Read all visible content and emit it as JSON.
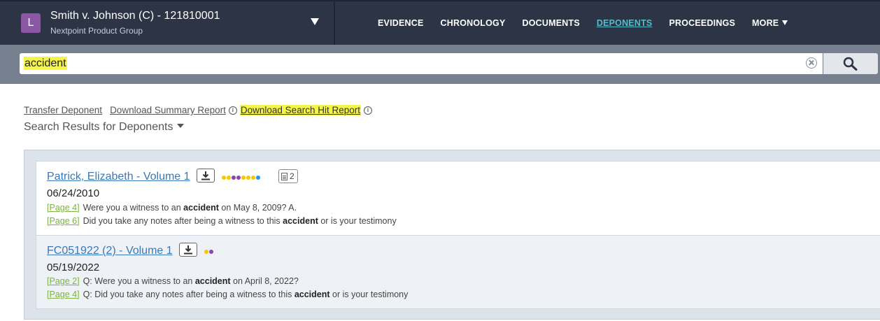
{
  "case": {
    "avatar_letter": "L",
    "title": "Smith v. Johnson (C) - 121810001",
    "subtitle": "Nextpoint Product Group"
  },
  "nav": {
    "items": [
      {
        "label": "EVIDENCE",
        "active": false
      },
      {
        "label": "CHRONOLOGY",
        "active": false
      },
      {
        "label": "DOCUMENTS",
        "active": false
      },
      {
        "label": "DEPONENTS",
        "active": true
      },
      {
        "label": "PROCEEDINGS",
        "active": false
      },
      {
        "label": "MORE",
        "active": false
      }
    ]
  },
  "search": {
    "value": "accident"
  },
  "actions": {
    "transfer_deponent": "Transfer Deponent",
    "download_summary": "Download Summary Report",
    "download_search_hit": "Download Search Hit Report"
  },
  "results_heading": "Search Results for Deponents",
  "colors": {
    "accent": "#56bcc8",
    "link": "#3a78b7",
    "page_link": "#7cb342",
    "highlight": "#f4f44a",
    "avatar": "#8b56a3"
  },
  "results": [
    {
      "title": "Patrick, Elizabeth - Volume 1",
      "date": "06/24/2010",
      "dot_colors": [
        "#f5c800",
        "#f5c800",
        "#8e44ad",
        "#8e44ad",
        "#f5c800",
        "#f5c800",
        "#f5c800",
        "#2196f3"
      ],
      "doc_count": "2",
      "hits": [
        {
          "page": "[Page 4]",
          "before": "Were you a witness to an ",
          "term": "accident",
          "after": " on May 8, 2009? A."
        },
        {
          "page": "[Page 6]",
          "before": "Did you take any notes after being a witness to this ",
          "term": "accident",
          "after": " or is your testimony"
        }
      ]
    },
    {
      "title": "FC051922 (2) - Volume 1",
      "date": "05/19/2022",
      "dot_colors": [
        "#f5c800",
        "#8e44ad"
      ],
      "doc_count": "",
      "hits": [
        {
          "page": "[Page 2]",
          "before": "Q: Were you a witness to an ",
          "term": "accident",
          "after": " on April 8, 2022?"
        },
        {
          "page": "[Page 4]",
          "before": "Q: Did you take any notes after being a witness to this ",
          "term": "accident",
          "after": " or is your testimony"
        }
      ]
    }
  ]
}
